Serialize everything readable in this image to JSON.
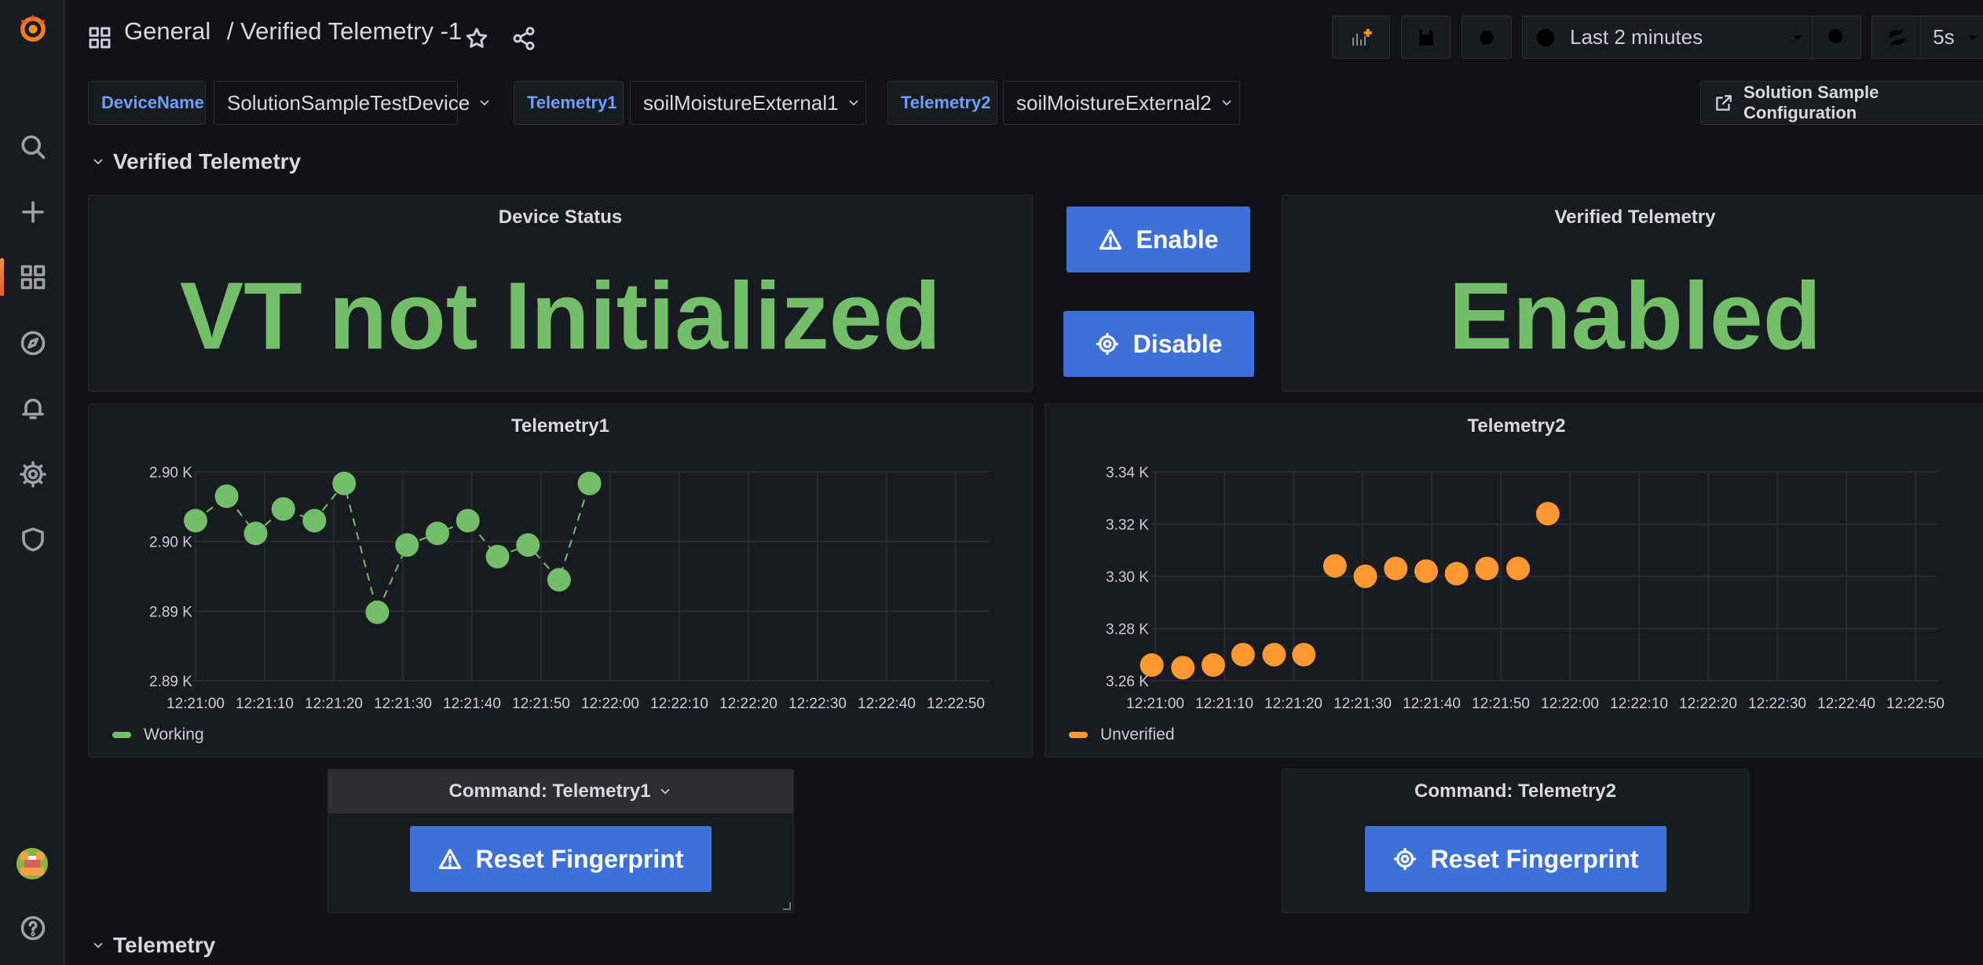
{
  "app": {
    "section": "General",
    "dashboard_title": "/ Verified Telemetry -1"
  },
  "toolbar": {
    "time_range": "Last 2 minutes",
    "refresh_interval": "5s"
  },
  "variables": [
    {
      "label": "DeviceName",
      "value": "SolutionSampleTestDevice"
    },
    {
      "label": "Telemetry1",
      "value": "soilMoistureExternal1"
    },
    {
      "label": "Telemetry2",
      "value": "soilMoistureExternal2"
    }
  ],
  "links": {
    "config_label": "Solution Sample Configuration"
  },
  "rows": {
    "verified": "Verified Telemetry",
    "telemetry": "Telemetry"
  },
  "device_status": {
    "title": "Device Status",
    "value": "VT not Initialized"
  },
  "controls": {
    "enable_label": "Enable",
    "disable_label": "Disable"
  },
  "verified_telemetry": {
    "title": "Verified Telemetry",
    "value": "Enabled"
  },
  "commands": {
    "cmd1_title": "Command: Telemetry1",
    "cmd2_title": "Command: Telemetry2",
    "reset_label": "Reset Fingerprint"
  },
  "colors": {
    "green": "#73bf69",
    "orange": "#ff9830",
    "blue": "#3d71d9",
    "var_label": "#6e9fff"
  },
  "chart_data": [
    {
      "type": "scatter",
      "title": "Telemetry1",
      "x": [
        "12:21:00",
        "12:21:05",
        "12:21:10",
        "12:21:15",
        "12:21:20",
        "12:21:25",
        "12:21:30",
        "12:21:35",
        "12:21:40",
        "12:21:45",
        "12:21:50",
        "12:21:55",
        "12:22:00",
        "12:22:05",
        "12:22:10",
        "12:22:15",
        "12:22:20",
        "12:22:25",
        "12:22:30",
        "12:22:35",
        "12:22:40",
        "12:22:45",
        "12:22:50",
        "12:22:55"
      ],
      "xticks": [
        "12:21:00",
        "12:21:10",
        "12:21:20",
        "12:21:30",
        "12:21:40",
        "12:21:50",
        "12:22:00",
        "12:22:10",
        "12:22:20",
        "12:22:30",
        "12:22:40",
        "12:22:50"
      ],
      "yticks": [
        "2.90 K",
        "2.90 K",
        "2.89 K",
        "2.89 K"
      ],
      "ylim": [
        2886,
        2904
      ],
      "connected": true,
      "series": [
        {
          "name": "Working",
          "color": "#73bf69",
          "points": [
            {
              "x": 0,
              "y": 2899.8
            },
            {
              "x": 4.5,
              "y": 2901.9
            },
            {
              "x": 8.7,
              "y": 2898.7
            },
            {
              "x": 12.7,
              "y": 2900.8
            },
            {
              "x": 17.2,
              "y": 2899.8
            },
            {
              "x": 21.5,
              "y": 2903.0
            },
            {
              "x": 26.3,
              "y": 2891.9
            },
            {
              "x": 30.6,
              "y": 2897.7
            },
            {
              "x": 35.0,
              "y": 2898.7
            },
            {
              "x": 39.4,
              "y": 2899.8
            },
            {
              "x": 43.7,
              "y": 2896.7
            },
            {
              "x": 48.1,
              "y": 2897.7
            },
            {
              "x": 52.6,
              "y": 2894.7
            },
            {
              "x": 57.0,
              "y": 2903.0
            }
          ]
        }
      ]
    },
    {
      "type": "scatter",
      "title": "Telemetry2",
      "xticks": [
        "12:21:00",
        "12:21:10",
        "12:21:20",
        "12:21:30",
        "12:21:40",
        "12:21:50",
        "12:22:00",
        "12:22:10",
        "12:22:20",
        "12:22:30",
        "12:22:40",
        "12:22:50"
      ],
      "yticks": [
        "3.34 K",
        "3.32 K",
        "3.30 K",
        "3.28 K",
        "3.26 K"
      ],
      "ylim": [
        3260,
        3340
      ],
      "connected": false,
      "series": [
        {
          "name": "Unverified",
          "color": "#ff9830",
          "points": [
            {
              "x": -0.5,
              "y": 3266
            },
            {
              "x": 4.0,
              "y": 3265
            },
            {
              "x": 8.4,
              "y": 3266
            },
            {
              "x": 12.7,
              "y": 3270
            },
            {
              "x": 17.2,
              "y": 3270
            },
            {
              "x": 21.5,
              "y": 3270
            },
            {
              "x": 26.0,
              "y": 3304
            },
            {
              "x": 30.4,
              "y": 3300
            },
            {
              "x": 34.8,
              "y": 3303
            },
            {
              "x": 39.2,
              "y": 3302
            },
            {
              "x": 43.6,
              "y": 3301
            },
            {
              "x": 48.0,
              "y": 3303
            },
            {
              "x": 52.5,
              "y": 3303
            },
            {
              "x": 56.8,
              "y": 3324
            }
          ]
        }
      ]
    }
  ]
}
